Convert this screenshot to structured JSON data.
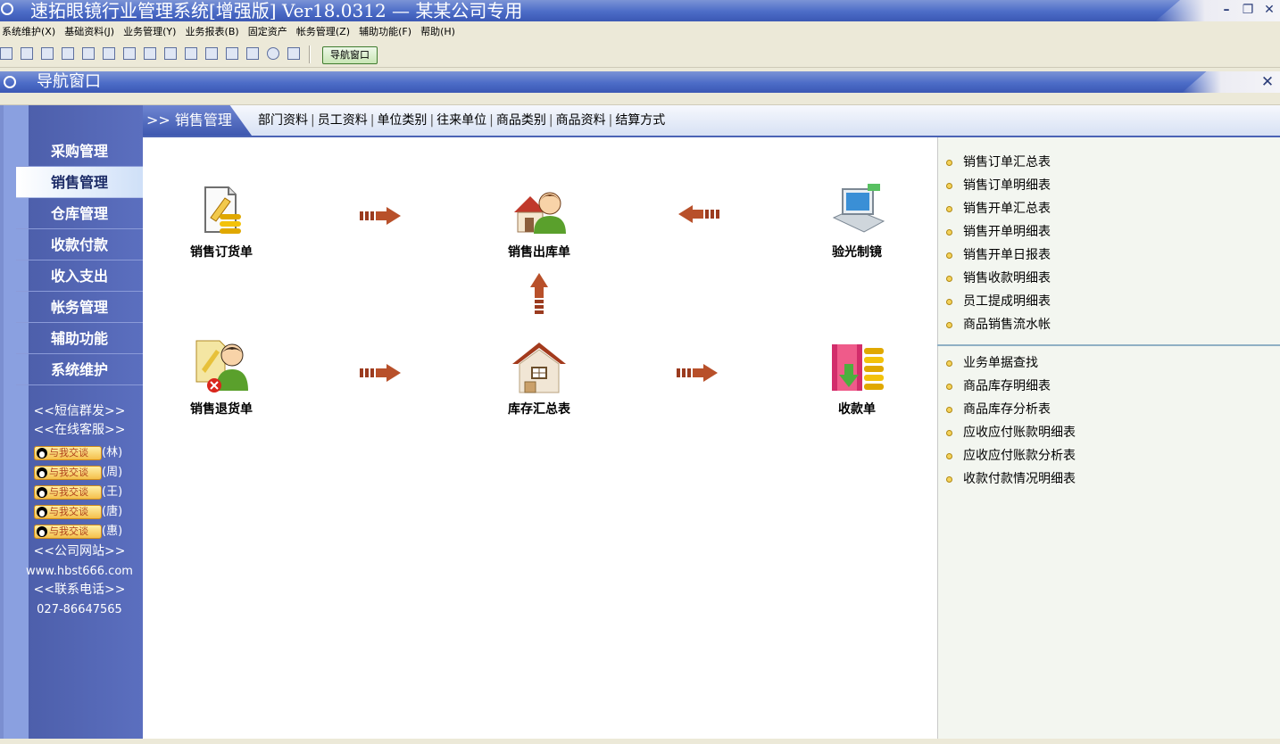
{
  "window": {
    "title": "速拓眼镜行业管理系统[增强版] Ver18.0312 — 某某公司专用"
  },
  "menu": [
    "系统维护(X)",
    "基础资料(J)",
    "业务管理(Y)",
    "业务报表(B)",
    "固定资产",
    "帐务管理(Z)",
    "辅助功能(F)",
    "帮助(H)"
  ],
  "toolbar": {
    "nav_button_label": "导航窗口"
  },
  "nav_window": {
    "title": "导航窗口"
  },
  "sidebar": {
    "items": [
      "采购管理",
      "销售管理",
      "仓库管理",
      "收款付款",
      "收入支出",
      "帐务管理",
      "辅助功能",
      "系统维护"
    ],
    "active_index": 1,
    "sms": "<<短信群发>>",
    "online_service": "<<在线客服>>",
    "qq_badge_label": "与我交谈",
    "contacts": [
      "(林)",
      "(周)",
      "(王)",
      "(唐)",
      "(惠)"
    ],
    "website_label": "<<公司网站>>",
    "website": "www.hbst666.com",
    "phone_label": "<<联系电话>>",
    "phone": "027-86647565"
  },
  "tabs": {
    "active_prefix": ">>",
    "active": "销售管理",
    "links": [
      "部门资料",
      "员工资料",
      "单位类别",
      "往来单位",
      "商品类别",
      "商品资料",
      "结算方式"
    ]
  },
  "flow": {
    "items": [
      "销售订货单",
      "销售出库单",
      "验光制镜",
      "销售退货单",
      "库存汇总表",
      "收款单"
    ]
  },
  "reports": {
    "group1": [
      "销售订单汇总表",
      "销售订单明细表",
      "销售开单汇总表",
      "销售开单明细表",
      "销售开单日报表",
      "销售收款明细表",
      "员工提成明细表",
      "商品销售流水帐"
    ],
    "group2": [
      "业务单据查找",
      "商品库存明细表",
      "商品库存分析表",
      "应收应付账款明细表",
      "应收应付账款分析表",
      "收款付款情况明细表"
    ]
  },
  "colors": {
    "title_blue": "#4c6cc7",
    "sidebar_blue": "#5b6fbf",
    "arrow_brown": "#9b3b1f",
    "report_dot": "#f4d25a"
  }
}
